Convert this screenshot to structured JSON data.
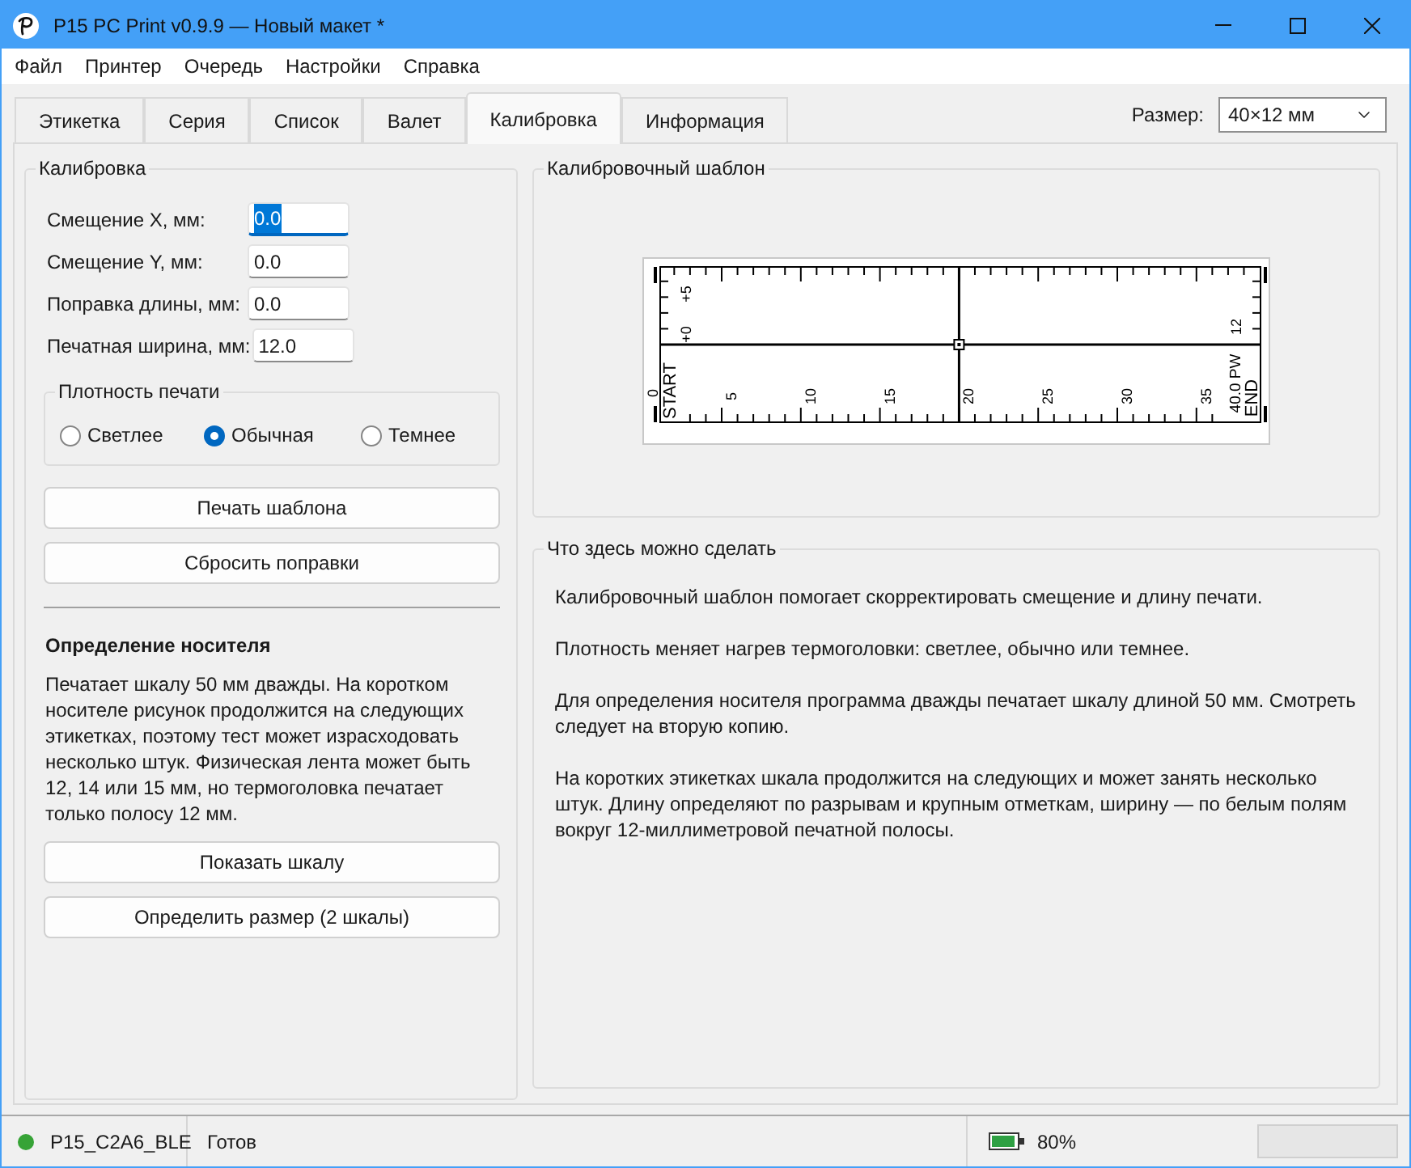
{
  "window": {
    "title": "P15 PC Print v0.9.9 — Новый макет *"
  },
  "menu": [
    "Файл",
    "Принтер",
    "Очередь",
    "Настройки",
    "Справка"
  ],
  "tabs": [
    {
      "label": "Этикетка",
      "selected": false
    },
    {
      "label": "Серия",
      "selected": false
    },
    {
      "label": "Список",
      "selected": false
    },
    {
      "label": "Валет",
      "selected": false
    },
    {
      "label": "Калибровка",
      "selected": true
    },
    {
      "label": "Информация",
      "selected": false
    }
  ],
  "size": {
    "label": "Размер:",
    "value": "40×12 мм"
  },
  "calibration": {
    "title": "Калибровка",
    "fields": [
      {
        "label": "Смещение X, мм:",
        "value": "0.0",
        "focused": true
      },
      {
        "label": "Смещение Y, мм:",
        "value": "0.0",
        "focused": false
      },
      {
        "label": "Поправка длины, мм:",
        "value": "0.0",
        "focused": false
      },
      {
        "label": "Печатная ширина, мм:",
        "value": "12.0",
        "focused": false
      }
    ],
    "density": {
      "title": "Плотность печати",
      "options": [
        {
          "label": "Светлее",
          "selected": false
        },
        {
          "label": "Обычная",
          "selected": true
        },
        {
          "label": "Темнее",
          "selected": false
        }
      ]
    },
    "buttons": [
      "Печать шаблона",
      "Сбросить поправки"
    ]
  },
  "media": {
    "title": "Определение носителя",
    "text": "Печатает шкалу 50 мм дважды. На коротком носителе рисунок продолжится на следующих этикетках, поэтому тест может израсходовать несколько штук. Физическая лента может быть 12, 14 или 15 мм, но термоголовка печатает только полосу 12 мм.",
    "buttons": [
      "Показать шкалу",
      "Определить размер (2 шкалы)"
    ]
  },
  "template": {
    "title": "Калибровочный шаблон",
    "offset_labels": [
      "+5",
      "+0"
    ],
    "zero_label": "0",
    "start_label": "START",
    "scale_labels": [
      "5",
      "10",
      "15",
      "20",
      "25",
      "30",
      "35"
    ],
    "length_label": "40.0 PW",
    "width_label": "12",
    "end_label": "END"
  },
  "help": {
    "title": "Что здесь можно сделать",
    "paragraphs": [
      "Калибровочный шаблон помогает скорректировать смещение и длину печати.",
      "Плотность меняет нагрев термоголовки: светлее, обычно или темнее.",
      "Для определения носителя программа дважды печатает шкалу длиной 50 мм. Смотреть следует на вторую копию.",
      "На коротких этикетках шкала продолжится на следующих и может занять несколько штук. Длину определяют по разрывам и крупным отметкам, ширину — по белым полям вокруг 12-миллиметровой печатной полосы."
    ]
  },
  "status_bar": {
    "device": "P15_C2A6_BLE",
    "connected": true,
    "status": "Готов",
    "battery": "80%"
  }
}
